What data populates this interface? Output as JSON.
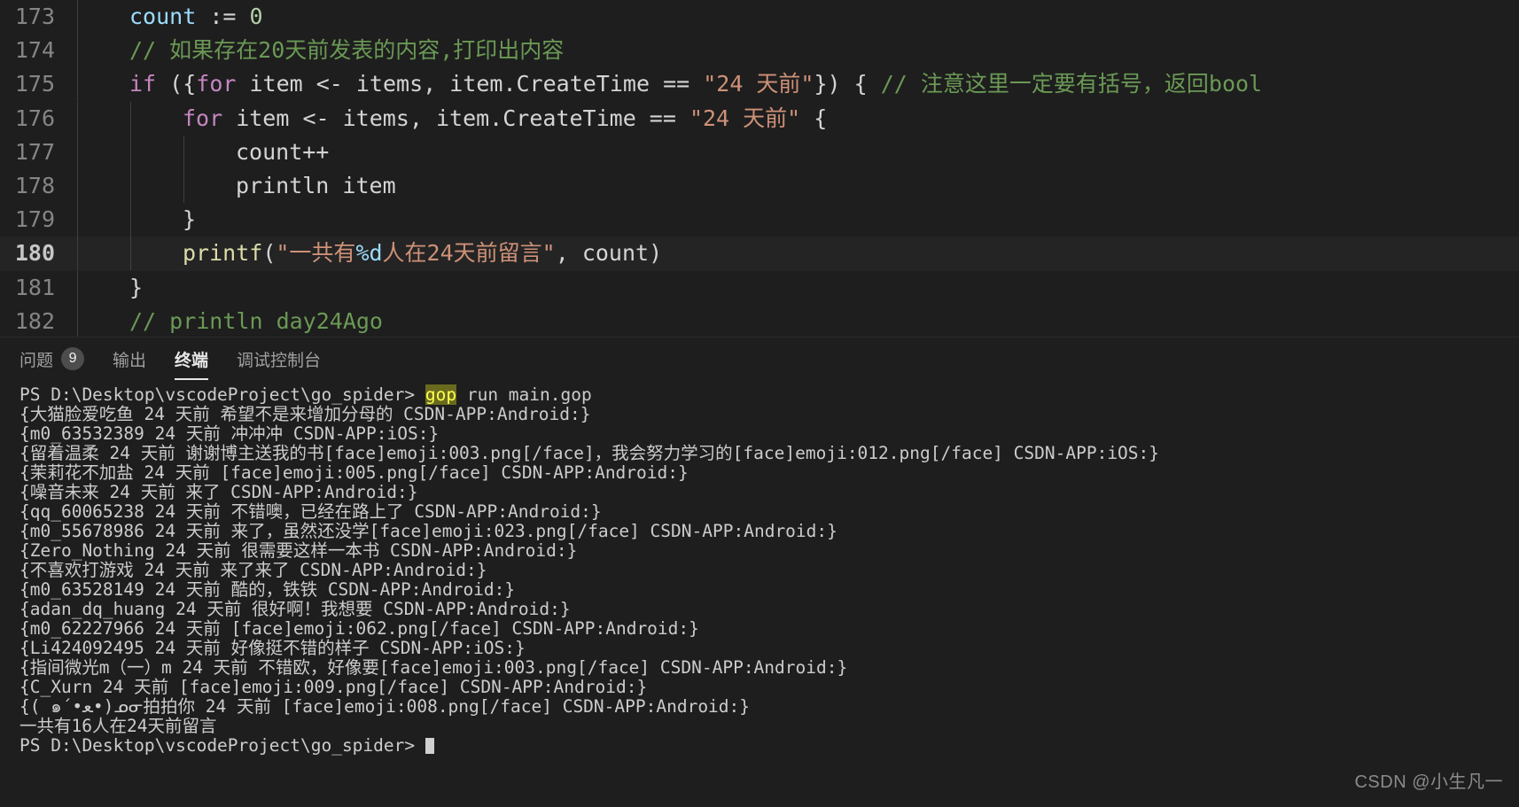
{
  "theme": {
    "editor_bg": "#1e1e1e",
    "panel_bg": "#1e1e1e",
    "line_number": "#858585",
    "active_line_bg": "#242424",
    "comment": "#6a9955",
    "string": "#ce9178",
    "keyword": "#c586c0",
    "function": "#dcdcaa",
    "variable": "#9cdcfe",
    "number": "#b5cea8",
    "terminal_fg": "#cccccc",
    "search_highlight_bg": "#6a6a1f",
    "search_highlight_fg": "#ffff4d"
  },
  "editor": {
    "active_line": 180,
    "language": "gop",
    "lines": [
      {
        "number": "173",
        "indent_guides": 1,
        "active": false,
        "tokens": [
          {
            "t": "count",
            "c": "tk-var"
          },
          {
            "t": " := ",
            "c": "tk-op"
          },
          {
            "t": "0",
            "c": "tk-num"
          }
        ]
      },
      {
        "number": "174",
        "indent_guides": 1,
        "active": false,
        "tokens": [
          {
            "t": "// 如果存在20天前发表的内容,打印出内容",
            "c": "tk-cmt"
          }
        ]
      },
      {
        "number": "175",
        "indent_guides": 1,
        "active": false,
        "tokens": [
          {
            "t": "if",
            "c": "tk-kw"
          },
          {
            "t": " ({",
            "c": "tk-op"
          },
          {
            "t": "for",
            "c": "tk-kw"
          },
          {
            "t": " item <- items, item.CreateTime == ",
            "c": "tk-plain"
          },
          {
            "t": "\"24 天前\"",
            "c": "tk-str"
          },
          {
            "t": "}) { ",
            "c": "tk-op"
          },
          {
            "t": "// 注意这里一定要有括号，返回bool",
            "c": "tk-cmt"
          }
        ]
      },
      {
        "number": "176",
        "indent_guides": 2,
        "active": false,
        "tokens": [
          {
            "t": "for",
            "c": "tk-kw"
          },
          {
            "t": " item <- items, item.CreateTime == ",
            "c": "tk-plain"
          },
          {
            "t": "\"24 天前\"",
            "c": "tk-str"
          },
          {
            "t": " {",
            "c": "tk-op"
          }
        ]
      },
      {
        "number": "177",
        "indent_guides": 3,
        "active": false,
        "tokens": [
          {
            "t": "count++",
            "c": "tk-plain"
          }
        ]
      },
      {
        "number": "178",
        "indent_guides": 3,
        "active": false,
        "tokens": [
          {
            "t": "println item",
            "c": "tk-plain"
          }
        ]
      },
      {
        "number": "179",
        "indent_guides": 2,
        "active": false,
        "tokens": [
          {
            "t": "}",
            "c": "tk-plain"
          }
        ]
      },
      {
        "number": "180",
        "indent_guides": 2,
        "active": true,
        "tokens": [
          {
            "t": "printf",
            "c": "tk-fn"
          },
          {
            "t": "(",
            "c": "tk-op"
          },
          {
            "t": "\"一共有",
            "c": "tk-str"
          },
          {
            "t": "%d",
            "c": "tk-pct"
          },
          {
            "t": "人在24天前留言\"",
            "c": "tk-str"
          },
          {
            "t": ", ",
            "c": "tk-op"
          },
          {
            "t": "count",
            "c": "tk-plain"
          },
          {
            "t": ")",
            "c": "tk-op"
          }
        ]
      },
      {
        "number": "181",
        "indent_guides": 1,
        "active": false,
        "tokens": [
          {
            "t": "}",
            "c": "tk-plain"
          }
        ]
      },
      {
        "number": "182",
        "indent_guides": 1,
        "active": false,
        "tokens": [
          {
            "t": "// println day24Ago",
            "c": "tk-cmt"
          }
        ]
      }
    ]
  },
  "panel": {
    "tabs": [
      {
        "label": "问题",
        "badge": "9",
        "active": false
      },
      {
        "label": "输出",
        "badge": "",
        "active": false
      },
      {
        "label": "终端",
        "badge": "",
        "active": true
      },
      {
        "label": "调试控制台",
        "badge": "",
        "active": false
      }
    ]
  },
  "terminal": {
    "prompt_path": "PS D:\\Desktop\\vscodeProject\\go_spider>",
    "command_highlight": "gop",
    "command_rest": " run main.gop",
    "lines": [
      "{大猫脸爱吃鱼 24 天前 希望不是来增加分母的 CSDN-APP:Android:}",
      "{m0_63532389 24 天前 冲冲冲 CSDN-APP:iOS:}",
      "{留着温柔 24 天前 谢谢博主送我的书[face]emoji:003.png[/face]，我会努力学习的[face]emoji:012.png[/face] CSDN-APP:iOS:}",
      "{茉莉花不加盐 24 天前 [face]emoji:005.png[/face] CSDN-APP:Android:}",
      "{噪音未来 24 天前 来了 CSDN-APP:Android:}",
      "{qq_60065238 24 天前 不错噢，已经在路上了 CSDN-APP:Android:}",
      "{m0_55678986 24 天前 来了，虽然还没学[face]emoji:023.png[/face] CSDN-APP:Android:}",
      "{Zero_Nothing 24 天前 很需要这样一本书 CSDN-APP:Android:}",
      "{不喜欢打游戏 24 天前 来了来了 CSDN-APP:Android:}",
      "{m0_63528149 24 天前 酷的，铁铁 CSDN-APP:Android:}",
      "{adan_dq_huang 24 天前 很好啊！我想要 CSDN-APP:Android:}",
      "{m0_62227966 24 天前 [face]emoji:062.png[/face] CSDN-APP:Android:}",
      "{Li424092495 24 天前 好像挺不错的样子 CSDN-APP:iOS:}",
      "{指间微光m（一）m 24 天前 不错欧，好像要[face]emoji:003.png[/face] CSDN-APP:Android:}",
      "{C_Xurn 24 天前 [face]emoji:009.png[/face] CSDN-APP:Android:}",
      "{( ๑´•ﻌ•)ᓄᓂ拍拍你 24 天前 [face]emoji:008.png[/face] CSDN-APP:Android:}",
      "一共有16人在24天前留言"
    ],
    "final_prompt": "PS D:\\Desktop\\vscodeProject\\go_spider>",
    "result_count": "16"
  },
  "watermark": "CSDN @小生凡一"
}
